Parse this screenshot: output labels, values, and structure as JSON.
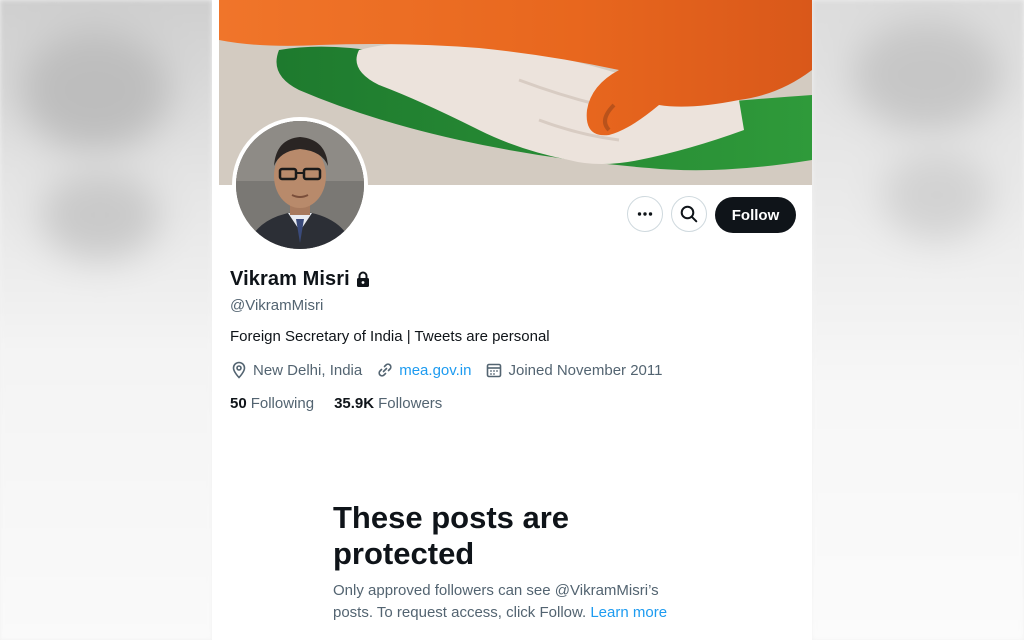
{
  "profile": {
    "name": "Vikram Misri",
    "handle": "@VikramMisri",
    "bio": "Foreign Secretary of India | Tweets are personal",
    "location": "New Delhi, India",
    "website": "mea.gov.in",
    "joined": "Joined November 2011",
    "following_count": "50",
    "following_label": "Following",
    "followers_count": "35.9K",
    "followers_label": "Followers",
    "protected": true
  },
  "actions": {
    "more_icon": "more-horizontal-icon",
    "search_icon": "search-icon",
    "follow_label": "Follow"
  },
  "protected_notice": {
    "title": "These posts are protected",
    "body": "Only approved followers can see @VikramMisri’s posts. To request access, click Follow.",
    "learn_more": "Learn more"
  },
  "colors": {
    "accent": "#1d9bf0",
    "text_primary": "#0f1419",
    "text_secondary": "#536471",
    "button_dark": "#0f1419"
  }
}
